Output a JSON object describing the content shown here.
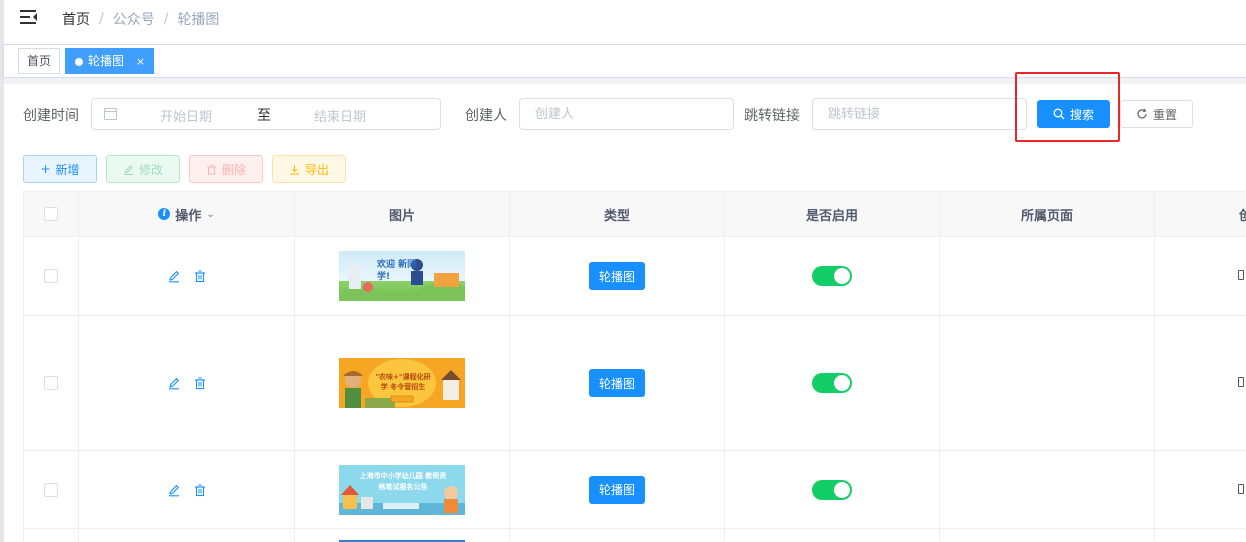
{
  "breadcrumb": [
    "首页",
    "公众号",
    "轮播图"
  ],
  "breadcrumb_separator": "/",
  "tags": [
    {
      "label": "首页",
      "active": false
    },
    {
      "label": "轮播图",
      "active": true,
      "close": "×"
    }
  ],
  "search": {
    "created_time_label": "创建时间",
    "start_placeholder": "开始日期",
    "range_separator": "至",
    "end_placeholder": "结束日期",
    "creator_label": "创建人",
    "creator_placeholder": "创建人",
    "link_label": "跳转链接",
    "link_placeholder": "跳转链接",
    "search_button": "搜索",
    "reset_button": "重置"
  },
  "toolbar": {
    "add": "新增",
    "edit": "修改",
    "delete": "删除",
    "export": "导出"
  },
  "table": {
    "headers": [
      "操作",
      "图片",
      "类型",
      "是否启用",
      "所属页面",
      "创"
    ],
    "rows": [
      {
        "type": "轮播图",
        "enabled": true,
        "page": "",
        "thumb_text": "欢迎 新同学!"
      },
      {
        "type": "轮播图",
        "enabled": true,
        "page": "",
        "thumb_text": "\"农味+\"课程化研学 冬令营招生"
      },
      {
        "type": "轮播图",
        "enabled": true,
        "page": "",
        "thumb_text": "上海市中小学幼儿园 教师资格笔试报名公告"
      }
    ]
  },
  "colors": {
    "primary": "#1890ff",
    "switch_on": "#13ce66",
    "highlight": "#e82828"
  }
}
